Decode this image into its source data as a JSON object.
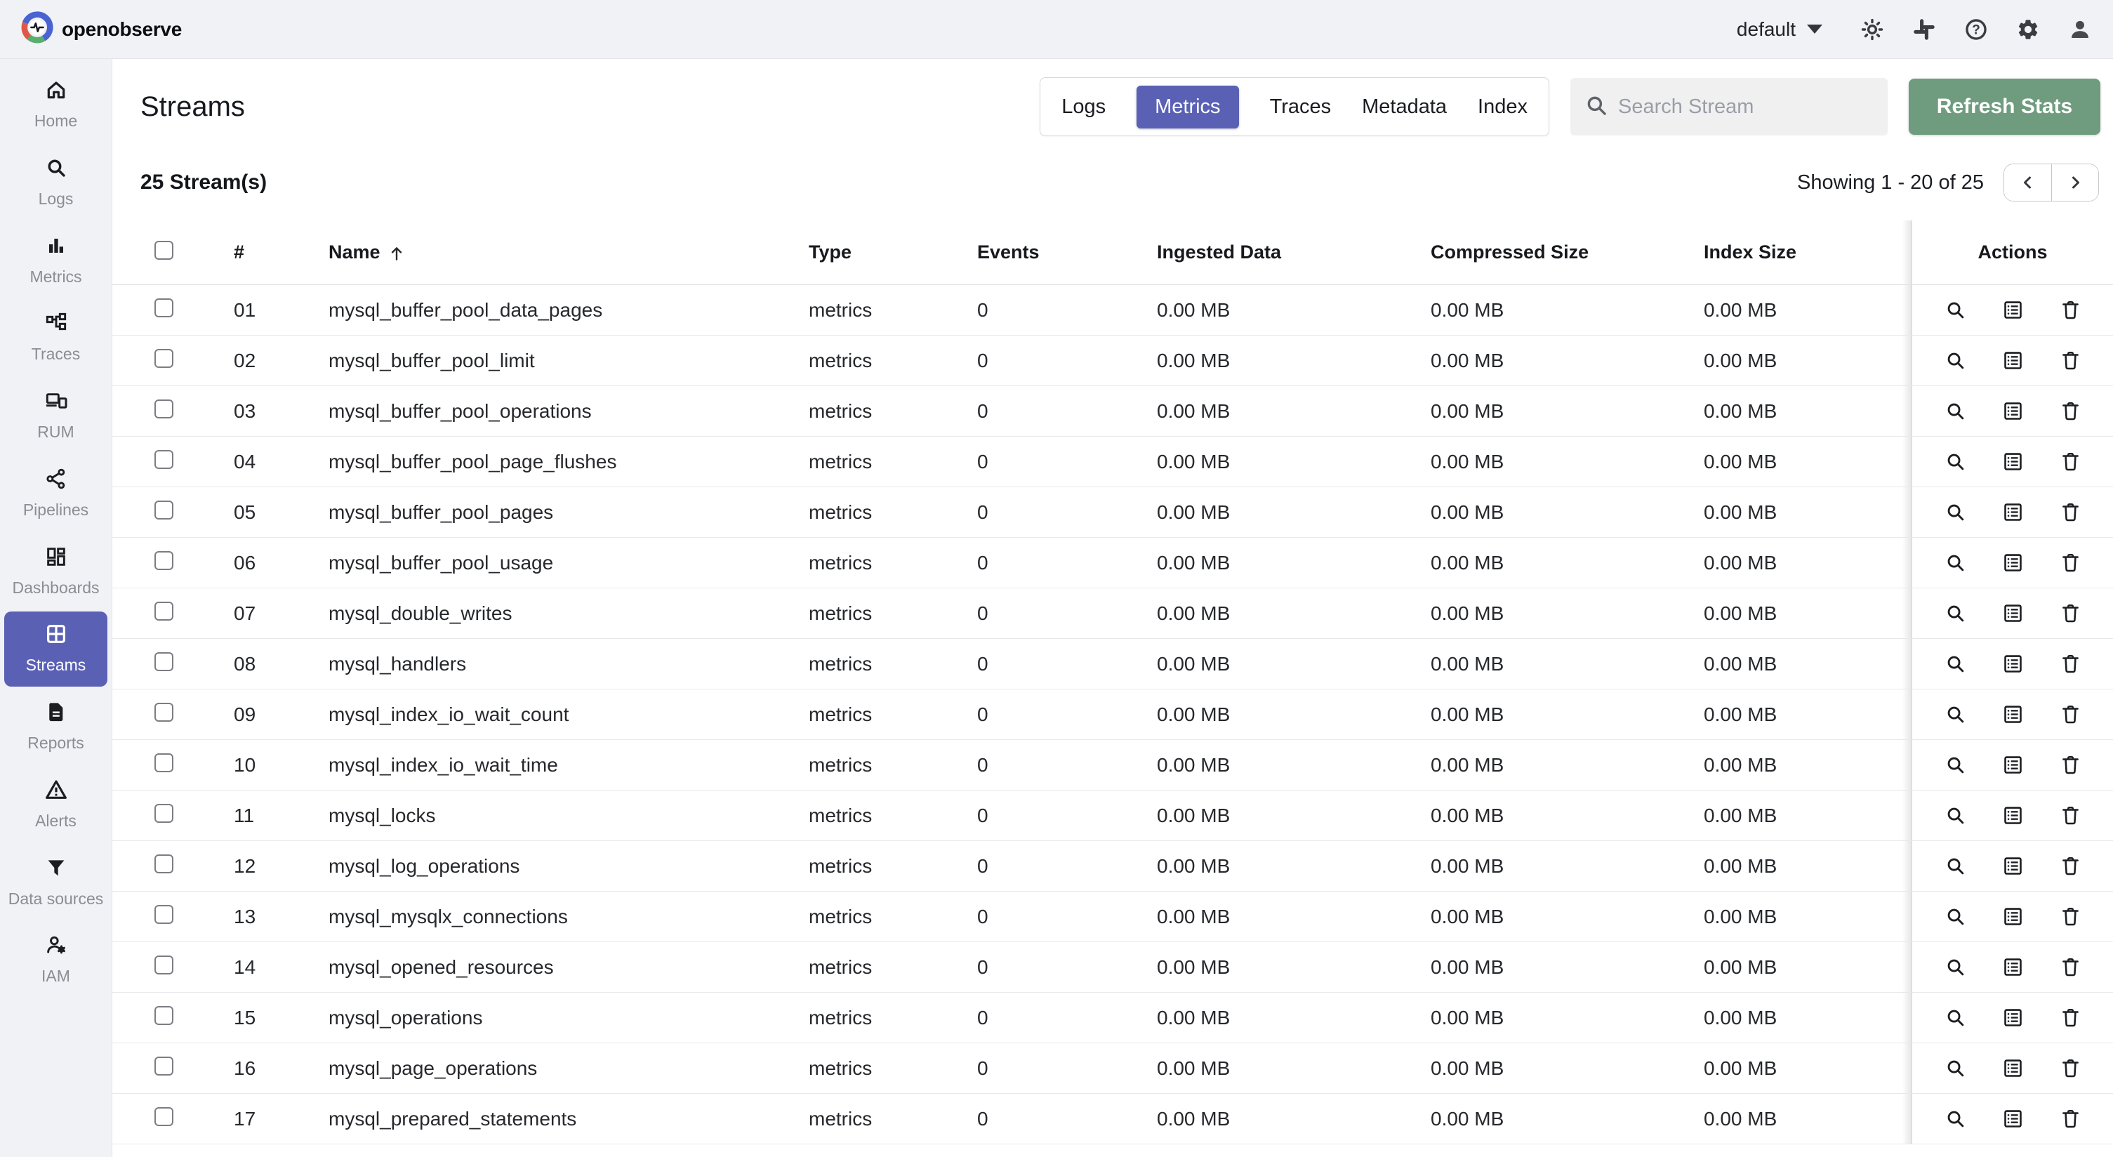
{
  "topbar": {
    "brand": "openobserve",
    "org_selector": "default",
    "icons": [
      "light-mode",
      "slack",
      "help",
      "settings",
      "profile"
    ]
  },
  "sidebar": {
    "items": [
      {
        "label": "Home",
        "icon": "home"
      },
      {
        "label": "Logs",
        "icon": "search"
      },
      {
        "label": "Metrics",
        "icon": "bar-chart"
      },
      {
        "label": "Traces",
        "icon": "sitemap"
      },
      {
        "label": "RUM",
        "icon": "devices"
      },
      {
        "label": "Pipelines",
        "icon": "share"
      },
      {
        "label": "Dashboards",
        "icon": "dashboard"
      },
      {
        "label": "Streams",
        "icon": "grid",
        "active": true
      },
      {
        "label": "Reports",
        "icon": "report"
      },
      {
        "label": "Alerts",
        "icon": "warning"
      },
      {
        "label": "Data sources",
        "icon": "filter"
      },
      {
        "label": "IAM",
        "icon": "user-gear"
      }
    ]
  },
  "header": {
    "title": "Streams",
    "tabs": [
      "Logs",
      "Metrics",
      "Traces",
      "Metadata",
      "Index"
    ],
    "active_tab": "Metrics",
    "search_placeholder": "Search Stream",
    "refresh_button": "Refresh Stats"
  },
  "stats": {
    "count_label": "25 Stream(s)",
    "showing_label": "Showing 1 - 20 of 25"
  },
  "table": {
    "columns": {
      "num": "#",
      "name": "Name",
      "type": "Type",
      "events": "Events",
      "ingested": "Ingested Data",
      "compressed": "Compressed Size",
      "index": "Index Size",
      "actions": "Actions"
    },
    "row_actions": [
      "explore",
      "details",
      "delete"
    ],
    "rows": [
      {
        "num": "01",
        "name": "mysql_buffer_pool_data_pages",
        "type": "metrics",
        "events": "0",
        "ingested": "0.00 MB",
        "compressed": "0.00 MB",
        "index": "0.00 MB"
      },
      {
        "num": "02",
        "name": "mysql_buffer_pool_limit",
        "type": "metrics",
        "events": "0",
        "ingested": "0.00 MB",
        "compressed": "0.00 MB",
        "index": "0.00 MB"
      },
      {
        "num": "03",
        "name": "mysql_buffer_pool_operations",
        "type": "metrics",
        "events": "0",
        "ingested": "0.00 MB",
        "compressed": "0.00 MB",
        "index": "0.00 MB"
      },
      {
        "num": "04",
        "name": "mysql_buffer_pool_page_flushes",
        "type": "metrics",
        "events": "0",
        "ingested": "0.00 MB",
        "compressed": "0.00 MB",
        "index": "0.00 MB"
      },
      {
        "num": "05",
        "name": "mysql_buffer_pool_pages",
        "type": "metrics",
        "events": "0",
        "ingested": "0.00 MB",
        "compressed": "0.00 MB",
        "index": "0.00 MB"
      },
      {
        "num": "06",
        "name": "mysql_buffer_pool_usage",
        "type": "metrics",
        "events": "0",
        "ingested": "0.00 MB",
        "compressed": "0.00 MB",
        "index": "0.00 MB"
      },
      {
        "num": "07",
        "name": "mysql_double_writes",
        "type": "metrics",
        "events": "0",
        "ingested": "0.00 MB",
        "compressed": "0.00 MB",
        "index": "0.00 MB"
      },
      {
        "num": "08",
        "name": "mysql_handlers",
        "type": "metrics",
        "events": "0",
        "ingested": "0.00 MB",
        "compressed": "0.00 MB",
        "index": "0.00 MB"
      },
      {
        "num": "09",
        "name": "mysql_index_io_wait_count",
        "type": "metrics",
        "events": "0",
        "ingested": "0.00 MB",
        "compressed": "0.00 MB",
        "index": "0.00 MB"
      },
      {
        "num": "10",
        "name": "mysql_index_io_wait_time",
        "type": "metrics",
        "events": "0",
        "ingested": "0.00 MB",
        "compressed": "0.00 MB",
        "index": "0.00 MB"
      },
      {
        "num": "11",
        "name": "mysql_locks",
        "type": "metrics",
        "events": "0",
        "ingested": "0.00 MB",
        "compressed": "0.00 MB",
        "index": "0.00 MB"
      },
      {
        "num": "12",
        "name": "mysql_log_operations",
        "type": "metrics",
        "events": "0",
        "ingested": "0.00 MB",
        "compressed": "0.00 MB",
        "index": "0.00 MB"
      },
      {
        "num": "13",
        "name": "mysql_mysqlx_connections",
        "type": "metrics",
        "events": "0",
        "ingested": "0.00 MB",
        "compressed": "0.00 MB",
        "index": "0.00 MB"
      },
      {
        "num": "14",
        "name": "mysql_opened_resources",
        "type": "metrics",
        "events": "0",
        "ingested": "0.00 MB",
        "compressed": "0.00 MB",
        "index": "0.00 MB"
      },
      {
        "num": "15",
        "name": "mysql_operations",
        "type": "metrics",
        "events": "0",
        "ingested": "0.00 MB",
        "compressed": "0.00 MB",
        "index": "0.00 MB"
      },
      {
        "num": "16",
        "name": "mysql_page_operations",
        "type": "metrics",
        "events": "0",
        "ingested": "0.00 MB",
        "compressed": "0.00 MB",
        "index": "0.00 MB"
      },
      {
        "num": "17",
        "name": "mysql_prepared_statements",
        "type": "metrics",
        "events": "0",
        "ingested": "0.00 MB",
        "compressed": "0.00 MB",
        "index": "0.00 MB"
      }
    ]
  },
  "colors": {
    "primary": "#5a61b5",
    "refresh_green": "#6f9c7e",
    "topbar_bg": "#f1f2f6"
  }
}
